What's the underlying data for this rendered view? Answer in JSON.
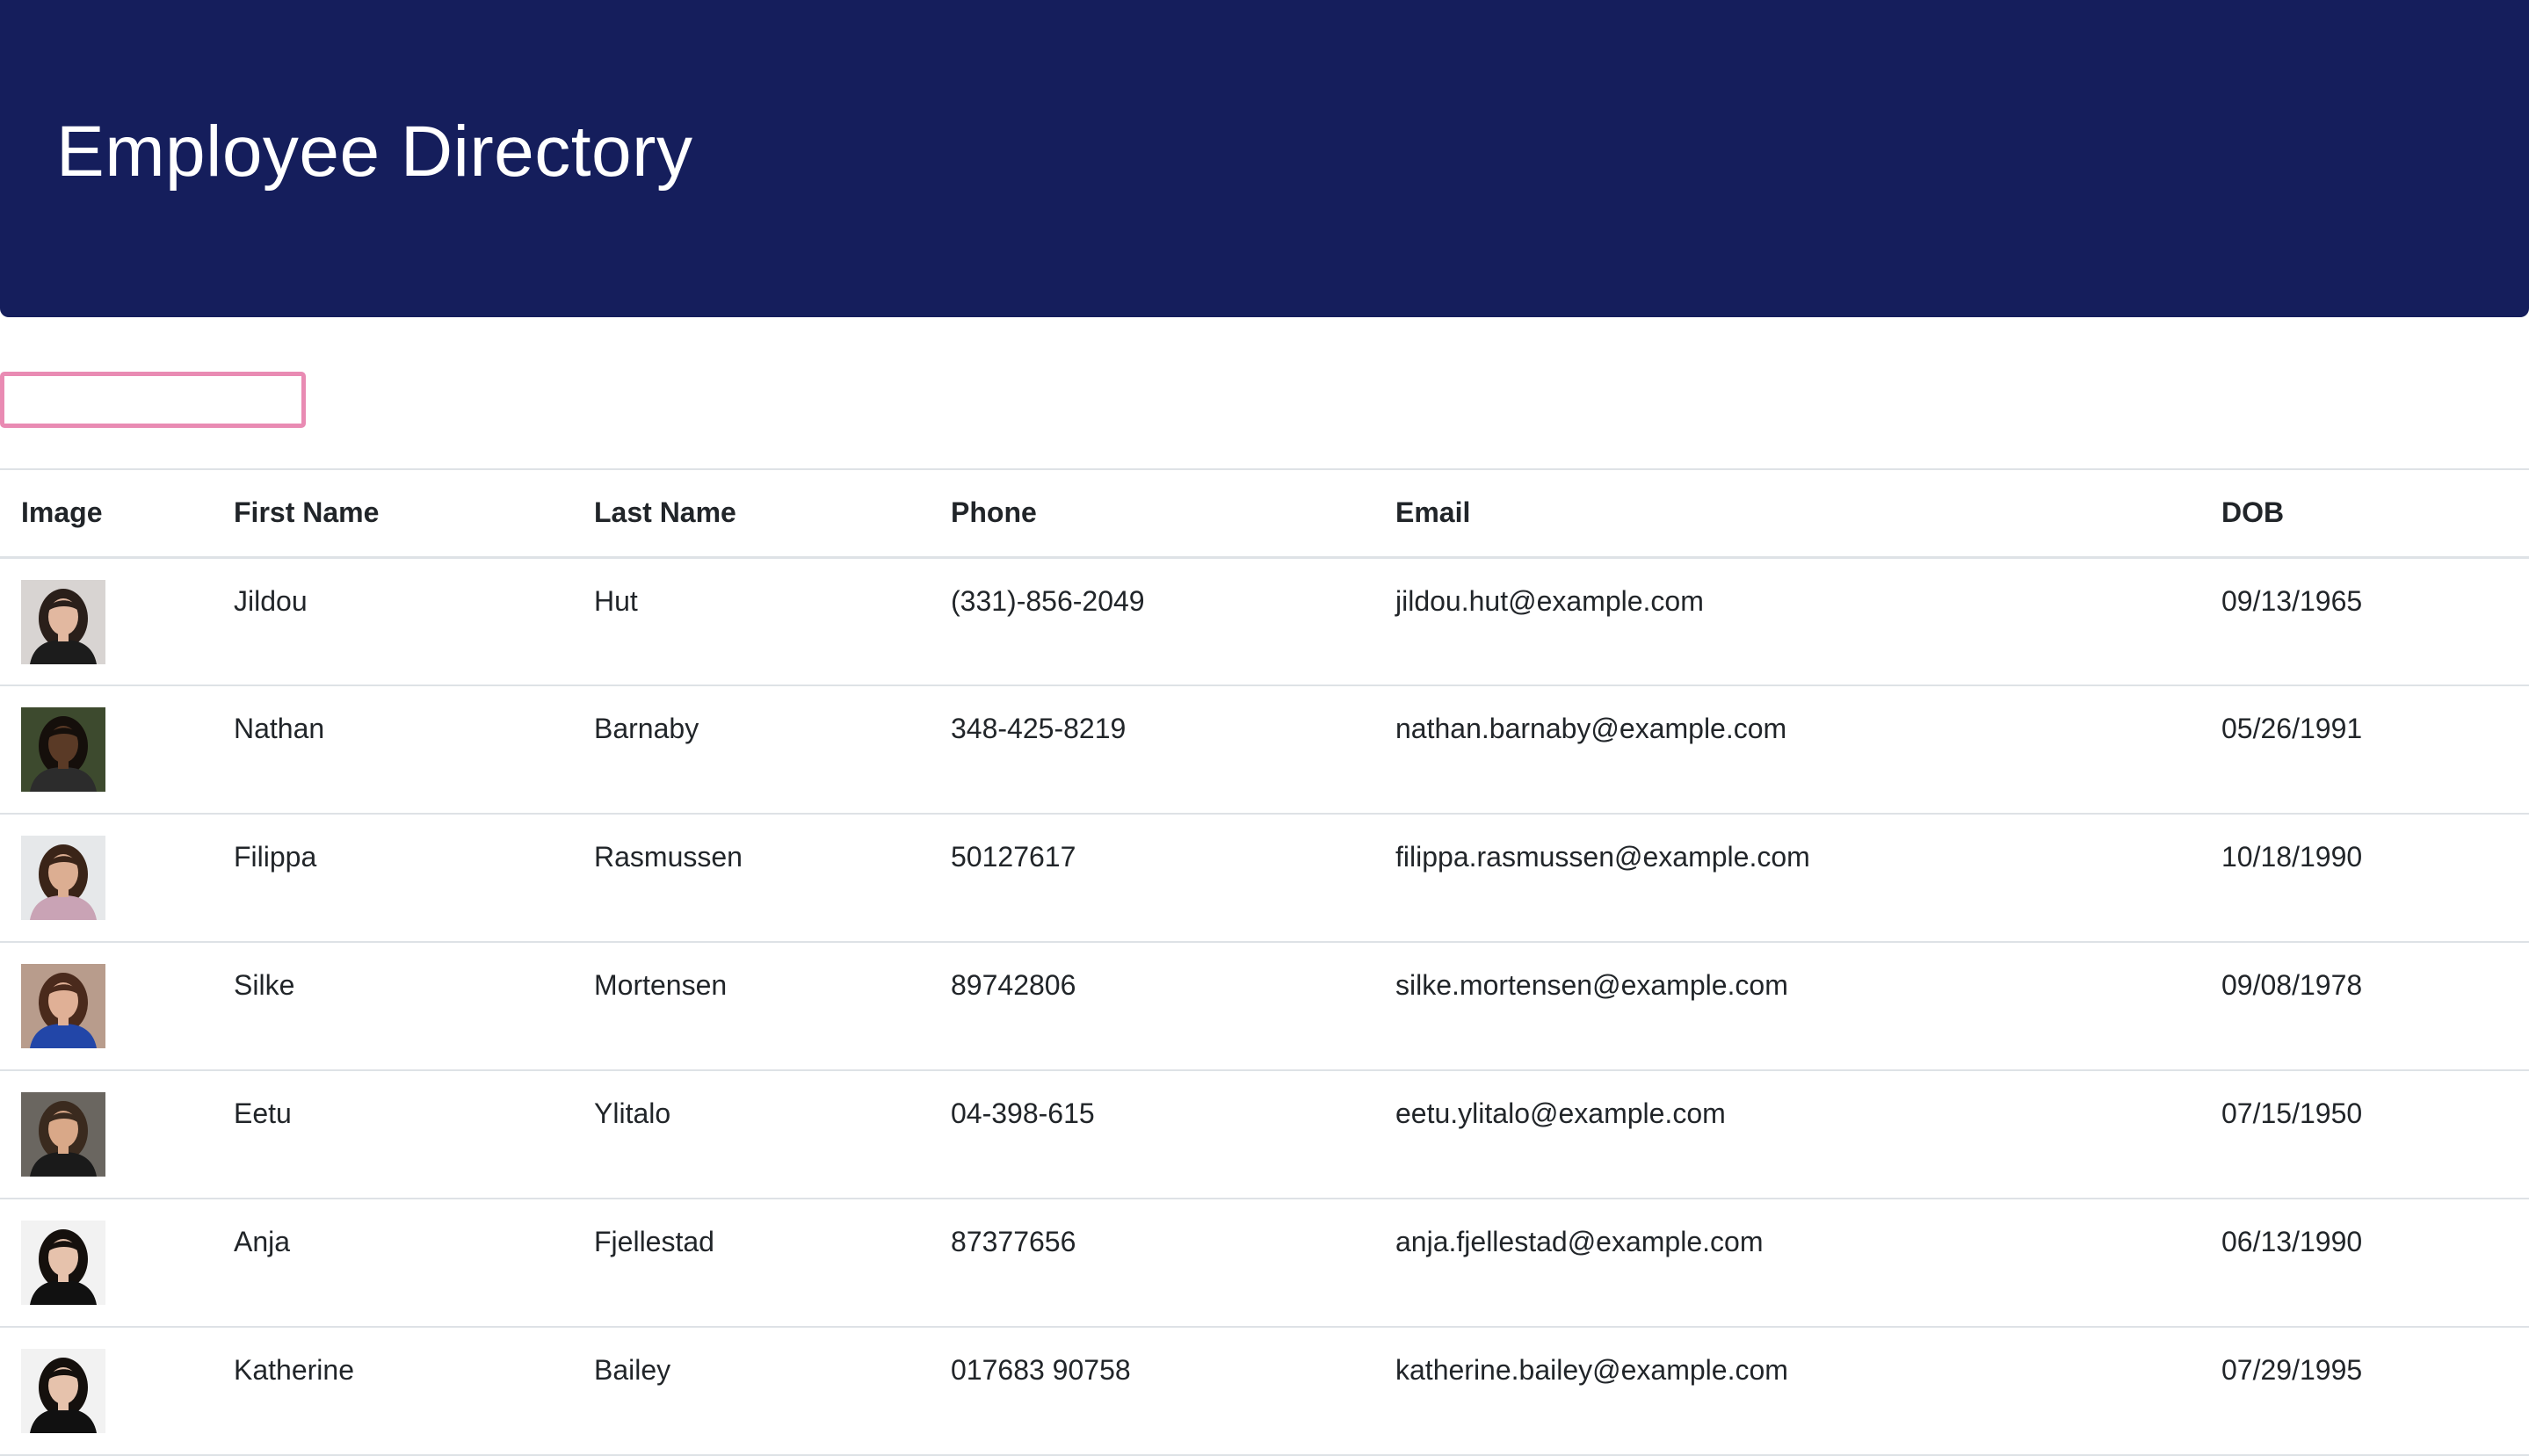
{
  "header": {
    "title": "Employee Directory",
    "background_color": "#151e5c"
  },
  "search": {
    "value": "",
    "placeholder": "",
    "focus_border_color": "#e98bb3"
  },
  "table": {
    "columns": [
      "Image",
      "First Name",
      "Last Name",
      "Phone",
      "Email",
      "DOB"
    ],
    "rows": [
      {
        "first": "Jildou",
        "last": "Hut",
        "phone": "(331)-856-2049",
        "email": "jildou.hut@example.com",
        "dob": "09/13/1965",
        "avatar": {
          "bg": "#d8d4d2",
          "hair": "#2a1f1a",
          "skin": "#e2b8a0",
          "shirt": "#1c1c1c"
        }
      },
      {
        "first": "Nathan",
        "last": "Barnaby",
        "phone": "348-425-8219",
        "email": "nathan.barnaby@example.com",
        "dob": "05/26/1991",
        "avatar": {
          "bg": "#3d4a2e",
          "hair": "#150f0b",
          "skin": "#5a3a26",
          "shirt": "#2c2c2c"
        }
      },
      {
        "first": "Filippa",
        "last": "Rasmussen",
        "phone": "50127617",
        "email": "filippa.rasmussen@example.com",
        "dob": "10/18/1990",
        "avatar": {
          "bg": "#e6e8ea",
          "hair": "#3a2418",
          "skin": "#dcae92",
          "shirt": "#c9a3b5"
        }
      },
      {
        "first": "Silke",
        "last": "Mortensen",
        "phone": "89742806",
        "email": "silke.mortensen@example.com",
        "dob": "09/08/1978",
        "avatar": {
          "bg": "#b89c8c",
          "hair": "#4a2a1c",
          "skin": "#e0b096",
          "shirt": "#2246a8"
        }
      },
      {
        "first": "Eetu",
        "last": "Ylitalo",
        "phone": "04-398-615",
        "email": "eetu.ylitalo@example.com",
        "dob": "07/15/1950",
        "avatar": {
          "bg": "#6a6660",
          "hair": "#3a2a1e",
          "skin": "#d9a888",
          "shirt": "#1a1a1a"
        }
      },
      {
        "first": "Anja",
        "last": "Fjellestad",
        "phone": "87377656",
        "email": "anja.fjellestad@example.com",
        "dob": "06/13/1990",
        "avatar": {
          "bg": "#f2f2f2",
          "hair": "#15100d",
          "skin": "#e6c2ac",
          "shirt": "#111111"
        }
      },
      {
        "first": "Katherine",
        "last": "Bailey",
        "phone": "017683 90758",
        "email": "katherine.bailey@example.com",
        "dob": "07/29/1995",
        "avatar": {
          "bg": "#f2f2f2",
          "hair": "#15100d",
          "skin": "#e6c2ac",
          "shirt": "#111111"
        }
      }
    ]
  }
}
